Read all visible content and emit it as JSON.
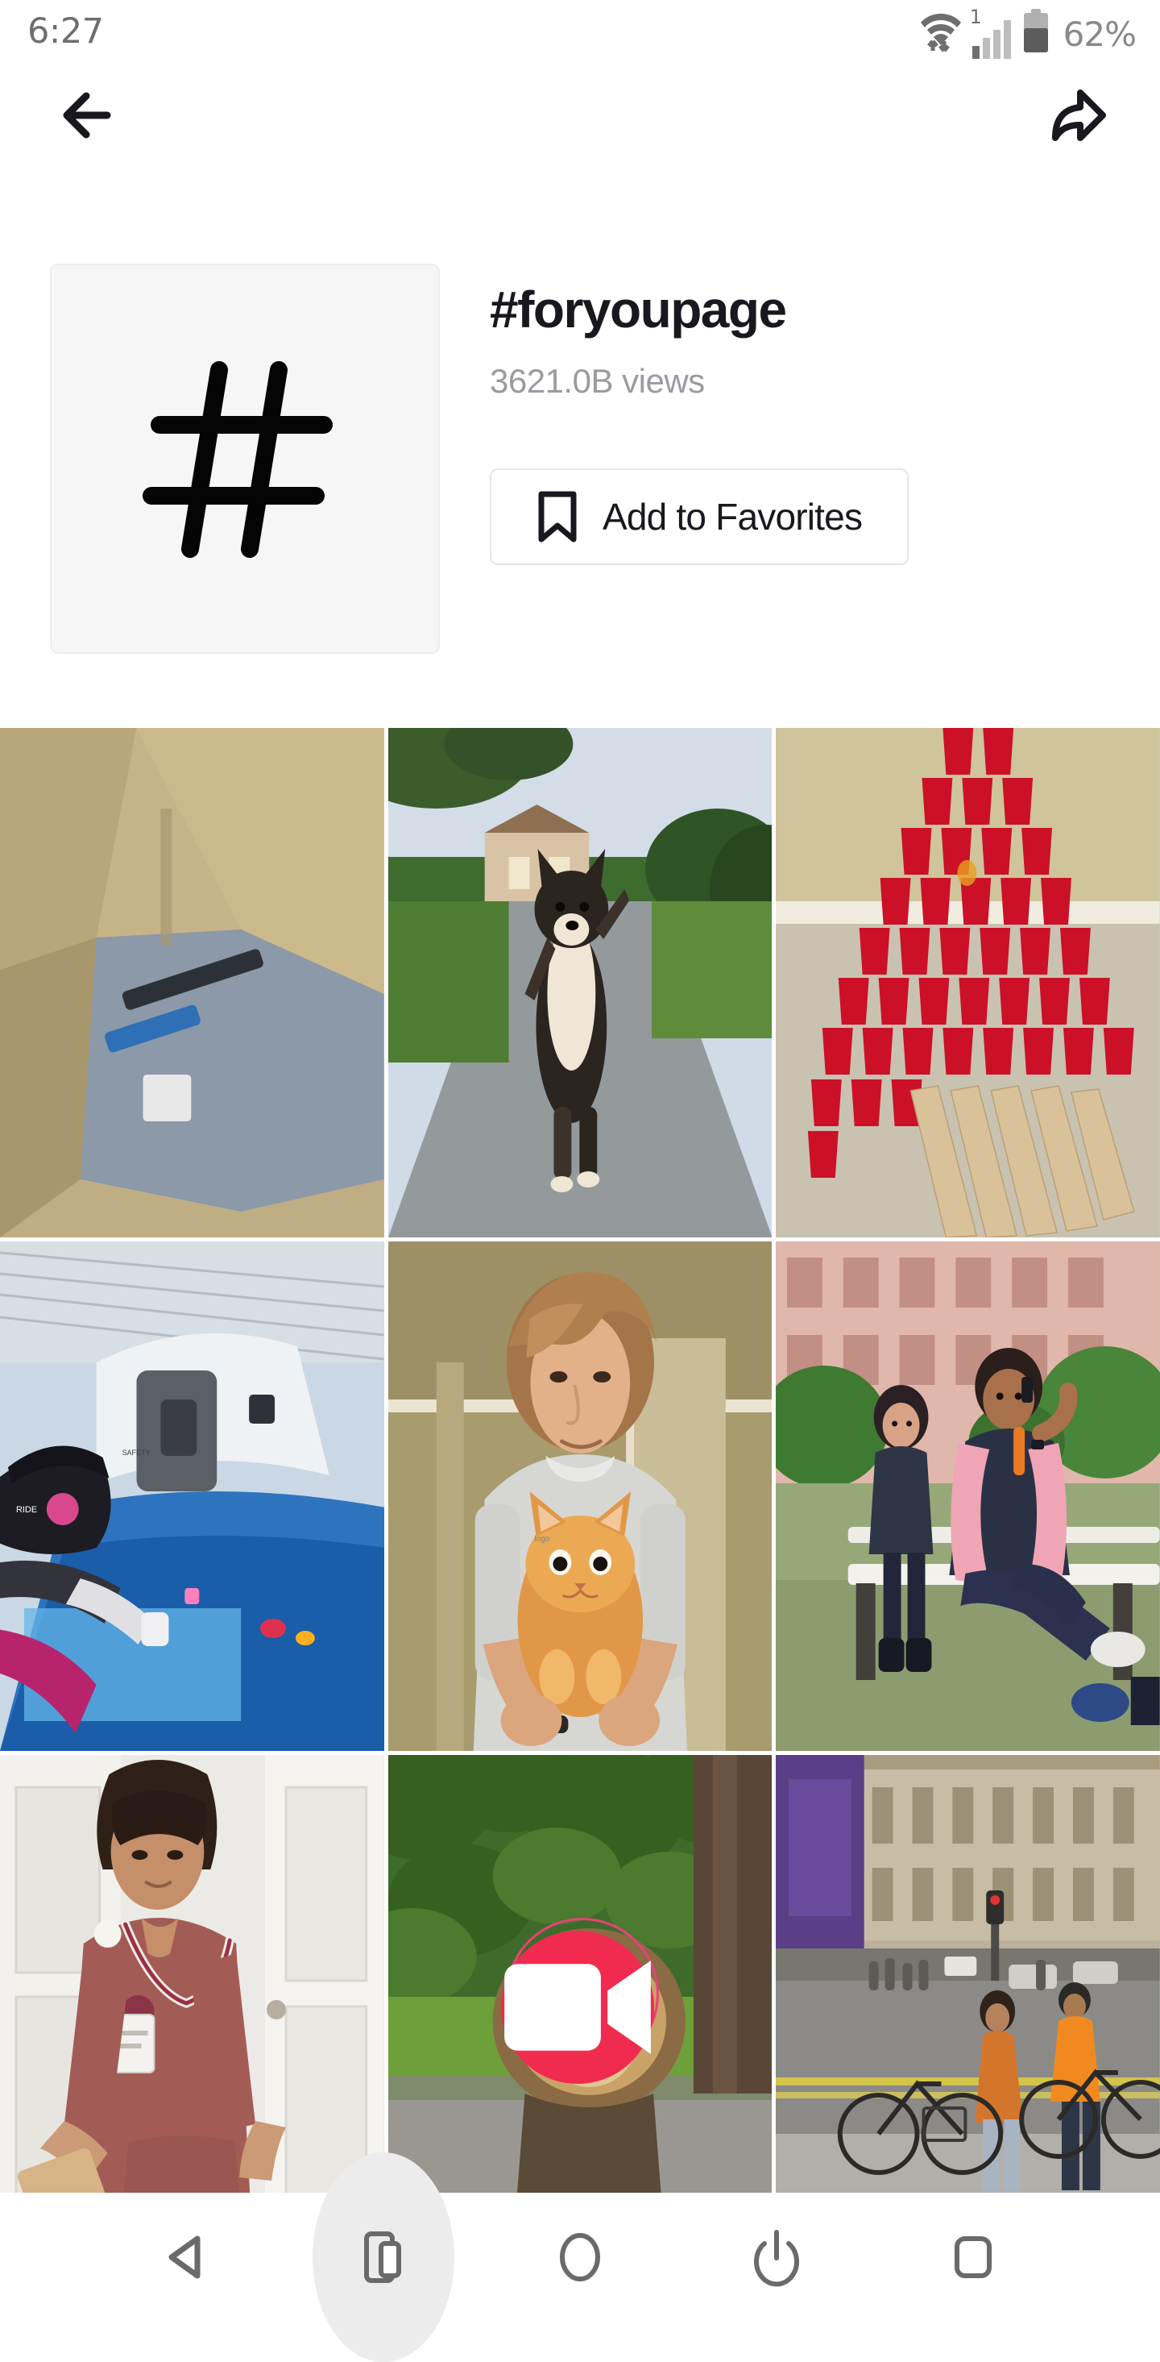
{
  "status_bar": {
    "time": "6:27",
    "battery_text": "62%",
    "battery_percent": 62,
    "signal_superscript": "1",
    "icons": [
      "wifi-transfer-icon",
      "signal-bars-icon",
      "battery-icon"
    ]
  },
  "top_nav": {
    "back_icon": "arrow-left-icon",
    "share_icon": "share-arrow-icon"
  },
  "hashtag": {
    "avatar_glyph": "#",
    "title": "#foryoupage",
    "views": "3621.0B views",
    "favorites_button": {
      "label": "Add to Favorites",
      "icon": "bookmark-icon"
    }
  },
  "video_grid": {
    "columns": 3,
    "tiles": [
      {
        "id": "tile-1",
        "description": "inside-cardboard-box",
        "has_overlay": false
      },
      {
        "id": "tile-2",
        "description": "dog-standing-on-driveway",
        "has_overlay": false
      },
      {
        "id": "tile-3",
        "description": "red-cup-pyramid",
        "has_overlay": false
      },
      {
        "id": "tile-4",
        "description": "person-in-helmet-on-ride",
        "has_overlay": false
      },
      {
        "id": "tile-5",
        "description": "teen-holding-orange-cat",
        "has_overlay": false
      },
      {
        "id": "tile-6",
        "description": "man-on-phone-on-bench",
        "has_overlay": false
      },
      {
        "id": "tile-7",
        "description": "nurse-in-scrubs-at-door",
        "has_overlay": false
      },
      {
        "id": "tile-8",
        "description": "lion-on-road",
        "has_overlay": true,
        "overlay_icon": "video-record-icon"
      },
      {
        "id": "tile-9",
        "description": "city-street-with-cyclists",
        "has_overlay": false
      }
    ]
  },
  "system_nav": {
    "items": [
      {
        "name": "back-button",
        "icon": "triangle-left-icon",
        "active": false
      },
      {
        "name": "screenshot-button",
        "icon": "phone-screenshot-icon",
        "active": true
      },
      {
        "name": "home-button",
        "icon": "circle-icon",
        "active": false
      },
      {
        "name": "power-button",
        "icon": "power-icon",
        "active": false
      },
      {
        "name": "recents-button",
        "icon": "square-icon",
        "active": false
      }
    ]
  },
  "colors": {
    "text_primary": "#18181f",
    "text_muted": "#9a9aa2",
    "record_red": "#f02b4f",
    "avatar_bg": "#f6f6f6",
    "nav_highlight": "#ececec"
  }
}
